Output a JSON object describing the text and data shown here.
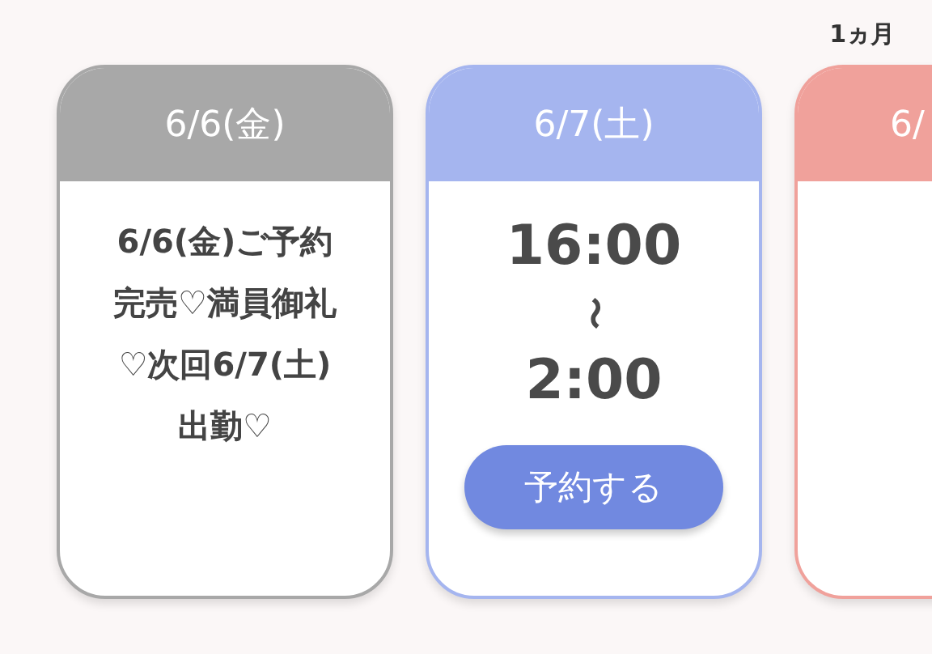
{
  "period_label": "1ヵ月",
  "days": [
    {
      "kind": "message",
      "date": "6/6(金)",
      "color": "#a8a8a8",
      "message_lines": [
        "6/6(金)ご予約",
        "完売♡満員御礼",
        "♡次回6/7(土)",
        "出勤♡"
      ]
    },
    {
      "kind": "hours",
      "date": "6/7(土)",
      "color": "#a5b5ef",
      "start": "16:00",
      "separator": "〜",
      "end": "2:00",
      "button": "予約する"
    },
    {
      "kind": "partial",
      "date": "6/",
      "color": "#f0a19b"
    }
  ]
}
